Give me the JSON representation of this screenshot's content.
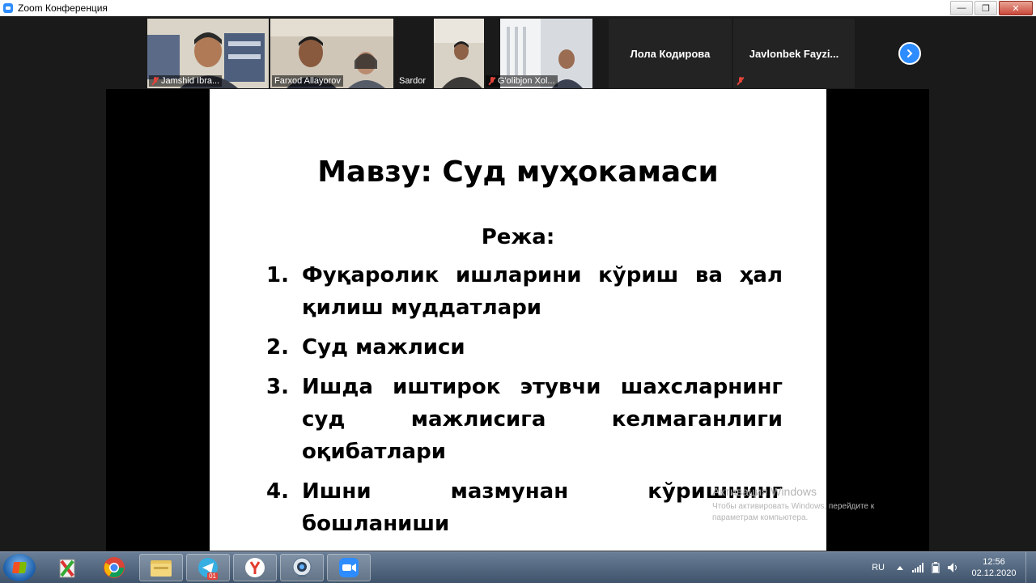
{
  "window": {
    "title": "Zoom Конференция",
    "controls": {
      "minimize": "—",
      "maximize": "❐",
      "close": "✕"
    }
  },
  "participants": [
    {
      "name": "Jamshid Ibra...",
      "muted": true,
      "video": true
    },
    {
      "name": "Farxod Allayorov",
      "muted": false,
      "video": true,
      "active_speaker": true
    },
    {
      "name": "Sardor",
      "muted": false,
      "video": true
    },
    {
      "name": "G'olibjon Xol...",
      "muted": true,
      "video": true
    },
    {
      "name": "Лола Кодирова",
      "muted": false,
      "video": false
    },
    {
      "name": "Javlonbek  Fayzi...",
      "muted": true,
      "video": false
    }
  ],
  "gallery_next_icon": "chevron-right-icon",
  "slide": {
    "title": "Мавзу: Суд муҳокамаси",
    "subtitle": "Режа:",
    "items": [
      {
        "num": "1.",
        "text": "Фуқаролик ишларини кўриш ва ҳал қилиш муддатлари"
      },
      {
        "num": "2.",
        "text": "Суд мажлиси"
      },
      {
        "num": "3.",
        "text": "Ишда иштирок этувчи шахсларнинг суд мажлисига келмаганлиги оқибатлари"
      },
      {
        "num": "4.",
        "text": "Ишни мазмунан кўришнинг бошланиши"
      }
    ]
  },
  "watermark": {
    "title": "Активация Windows",
    "text": "Чтобы активировать Windows, перейдите к параметрам компьютера."
  },
  "taskbar": {
    "apps": [
      {
        "name": "start-orb-icon"
      },
      {
        "name": "winrar-icon"
      },
      {
        "name": "chrome-icon"
      },
      {
        "name": "file-explorer-icon"
      },
      {
        "name": "telegram-icon",
        "badge": "01"
      },
      {
        "name": "yandex-browser-icon"
      },
      {
        "name": "webcam-app-icon"
      },
      {
        "name": "zoom-icon"
      }
    ],
    "tray": {
      "language": "RU",
      "time": "12:56",
      "date": "02.12.2020"
    }
  },
  "colors": {
    "zoom_blue": "#2d8cff",
    "active_speaker": "#3ec04a",
    "mute_red": "#e0443a"
  }
}
